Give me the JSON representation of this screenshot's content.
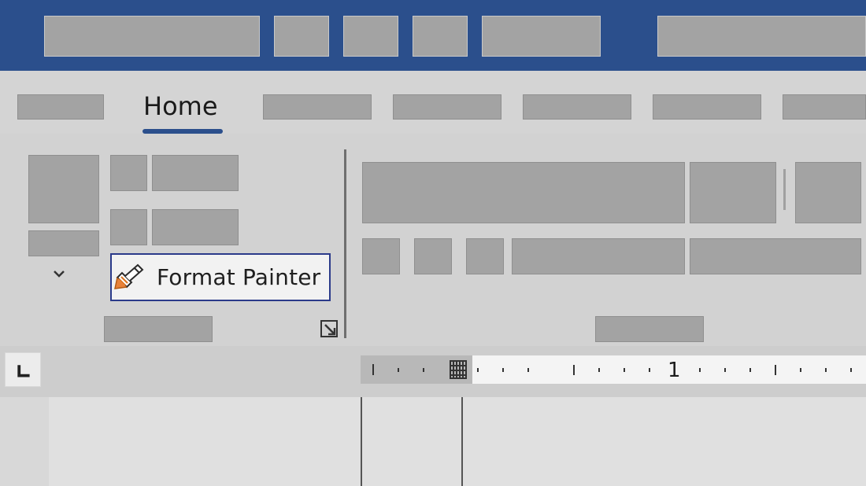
{
  "ribbon": {
    "active_tab": "Home",
    "clipboard": {
      "format_painter_label": "Format Painter"
    }
  },
  "ruler": {
    "marker_label": "1"
  },
  "colors": {
    "title_bar": "#2b4f8c",
    "active_tab_underline": "#2b4f8c",
    "ribbon_background": "#d2d2d2",
    "focus_border": "#2b3a8a"
  },
  "icons": [
    "paintbrush-icon",
    "chevron-down-icon",
    "dialog-launcher-icon",
    "tab-stop-icon"
  ]
}
